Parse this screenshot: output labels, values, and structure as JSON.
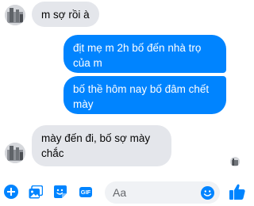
{
  "messages": [
    {
      "sender": "other",
      "text": "m sợ rồi à"
    },
    {
      "sender": "me",
      "text": "địt mẹ m 2h bố đến nhà trọ của m"
    },
    {
      "sender": "me",
      "text": "bố thề hôm nay bố đâm chết mày"
    },
    {
      "sender": "other",
      "text": "mày đến đi, bố sợ mày chắc"
    }
  ],
  "composer": {
    "placeholder": "Aa",
    "gif_label": "GIF",
    "icons": [
      "plus-circle-icon",
      "photo-icon",
      "sticker-icon",
      "gif-icon",
      "emoji-icon",
      "thumbs-up-icon"
    ]
  },
  "colors": {
    "accent": "#0084ff",
    "incoming_bubble": "#e4e6eb",
    "outgoing_text": "#ffffff",
    "incoming_text": "#050505"
  }
}
